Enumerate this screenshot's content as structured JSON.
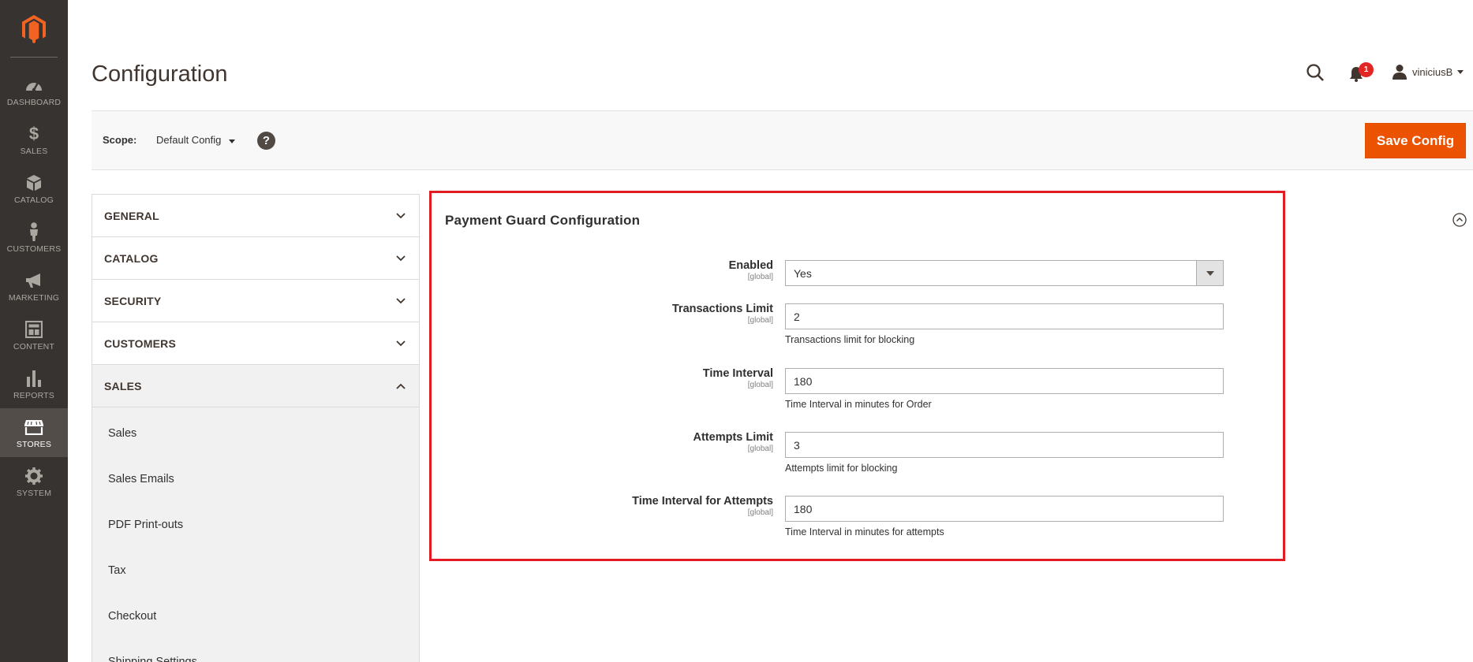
{
  "menu": [
    {
      "label": "DASHBOARD",
      "icon": "dashboard-icon"
    },
    {
      "label": "SALES",
      "icon": "dollar-icon"
    },
    {
      "label": "CATALOG",
      "icon": "box-icon"
    },
    {
      "label": "CUSTOMERS",
      "icon": "person-icon"
    },
    {
      "label": "MARKETING",
      "icon": "megaphone-icon"
    },
    {
      "label": "CONTENT",
      "icon": "layout-icon"
    },
    {
      "label": "REPORTS",
      "icon": "bar-chart-icon"
    },
    {
      "label": "STORES",
      "icon": "store-icon"
    },
    {
      "label": "SYSTEM",
      "icon": "gear-icon"
    }
  ],
  "header": {
    "title": "Configuration",
    "notifications_count": "1",
    "username": "viniciusB"
  },
  "scope": {
    "label": "Scope:",
    "value": "Default Config",
    "help": "?"
  },
  "save_button": "Save Config",
  "tabs": {
    "general": "GENERAL",
    "catalog": "CATALOG",
    "security": "SECURITY",
    "customers": "CUSTOMERS",
    "sales": "SALES",
    "sales_items": [
      "Sales",
      "Sales Emails",
      "PDF Print-outs",
      "Tax",
      "Checkout",
      "Shipping Settings"
    ]
  },
  "section": {
    "title": "Payment Guard Configuration",
    "fields": {
      "enabled": {
        "label": "Enabled",
        "scope": "[global]",
        "value": "Yes"
      },
      "transactions_limit": {
        "label": "Transactions Limit",
        "scope": "[global]",
        "value": "2",
        "note": "Transactions limit for blocking"
      },
      "time_interval": {
        "label": "Time Interval",
        "scope": "[global]",
        "value": "180",
        "note": "Time Interval in minutes for Order"
      },
      "attempts_limit": {
        "label": "Attempts Limit",
        "scope": "[global]",
        "value": "3",
        "note": "Attempts limit for blocking"
      },
      "time_interval_attempts": {
        "label": "Time Interval for Attempts",
        "scope": "[global]",
        "value": "180",
        "note": "Time Interval in minutes for attempts"
      }
    }
  },
  "colors": {
    "menu_bg": "#373330",
    "accent": "#eb5202",
    "highlight_border": "#e31c23",
    "badge": "#e22626"
  }
}
